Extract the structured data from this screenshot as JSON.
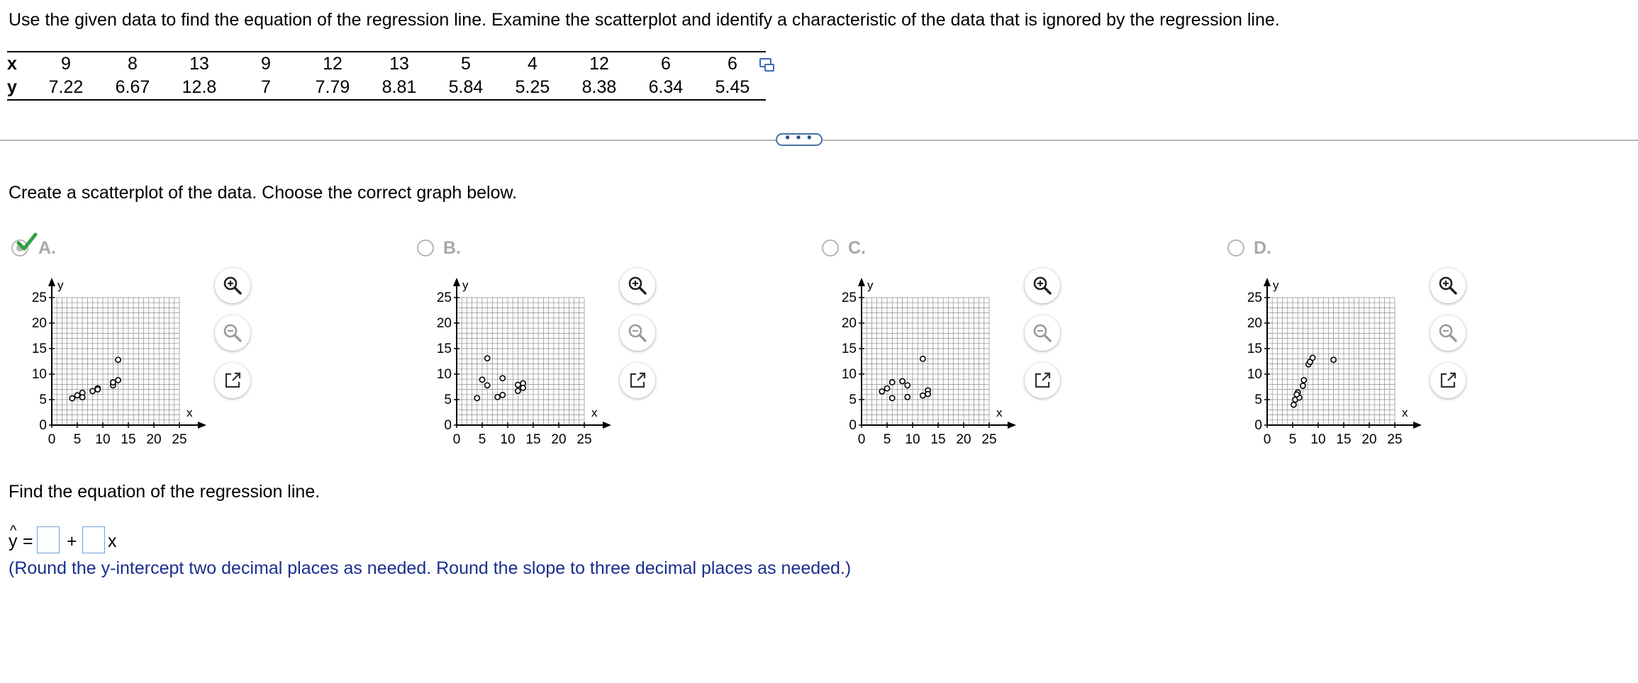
{
  "problem": {
    "prompt": "Use the given data to find the equation of the regression line. Examine the scatterplot and identify a characteristic of the data that is ignored by the regression line.",
    "table": {
      "x_label": "x",
      "y_label": "y",
      "x": [
        "9",
        "8",
        "13",
        "9",
        "12",
        "13",
        "5",
        "4",
        "12",
        "6",
        "6"
      ],
      "y": [
        "7.22",
        "6.67",
        "12.8",
        "7",
        "7.79",
        "8.81",
        "5.84",
        "5.25",
        "8.38",
        "6.34",
        "5.45"
      ]
    },
    "copy_icon": "copy-data-icon",
    "more_button": "• • •"
  },
  "question1": {
    "instruction": "Create a scatterplot of the data. Choose the correct graph below.",
    "selected": "A",
    "tools": [
      "zoom-in-icon",
      "zoom-out-icon",
      "pop-out-icon"
    ],
    "options": [
      {
        "label": "A.",
        "points": [
          [
            9,
            7.22
          ],
          [
            8,
            6.67
          ],
          [
            13,
            12.8
          ],
          [
            9,
            7
          ],
          [
            12,
            7.79
          ],
          [
            13,
            8.81
          ],
          [
            5,
            5.84
          ],
          [
            4,
            5.25
          ],
          [
            12,
            8.38
          ],
          [
            6,
            6.34
          ],
          [
            6,
            5.45
          ]
        ]
      },
      {
        "label": "B.",
        "points": [
          [
            4,
            5.3
          ],
          [
            5,
            8.9
          ],
          [
            6,
            13.1
          ],
          [
            6,
            7.8
          ],
          [
            8,
            5.5
          ],
          [
            9,
            9.2
          ],
          [
            9,
            5.9
          ],
          [
            12,
            6.7
          ],
          [
            12,
            7.9
          ],
          [
            13,
            8.2
          ],
          [
            13,
            7.3
          ]
        ]
      },
      {
        "label": "C.",
        "points": [
          [
            4,
            6.6
          ],
          [
            5,
            7.2
          ],
          [
            6,
            5.3
          ],
          [
            6,
            8.4
          ],
          [
            8,
            8.6
          ],
          [
            9,
            7.8
          ],
          [
            9,
            5.5
          ],
          [
            12,
            5.8
          ],
          [
            12,
            13.0
          ],
          [
            13,
            6.8
          ],
          [
            13,
            6.1
          ]
        ]
      },
      {
        "label": "D.",
        "points": [
          [
            5.2,
            4.0
          ],
          [
            5.5,
            5.0
          ],
          [
            6.0,
            6.4
          ],
          [
            6.3,
            5.4
          ],
          [
            7.0,
            7.7
          ],
          [
            7.2,
            8.8
          ],
          [
            8.1,
            11.9
          ],
          [
            8.4,
            12.4
          ],
          [
            8.9,
            13.2
          ],
          [
            13.0,
            12.8
          ],
          [
            5.8,
            6.0
          ]
        ]
      }
    ],
    "axes": {
      "x_label": "x",
      "y_label": "y",
      "x_range": [
        0,
        25
      ],
      "y_range": [
        0,
        25
      ],
      "x_ticks": [
        "0",
        "5",
        "10",
        "15",
        "20",
        "25"
      ],
      "y_ticks": [
        "0",
        "5",
        "10",
        "15",
        "20",
        "25"
      ],
      "grid": true
    }
  },
  "question2": {
    "heading": "Find the equation of the regression line.",
    "lhs": "y",
    "hat": "^",
    "equals": "=",
    "plus": "+",
    "x_var": "x",
    "intercept_value": "",
    "slope_value": "",
    "note": "(Round the y-intercept two decimal places as needed. Round the slope to three decimal places as needed.)"
  },
  "colors": {
    "check": "#2ea043",
    "note": "#1a2f8f",
    "radio": "#b5b5b5",
    "grid": "#8a8a8a"
  }
}
